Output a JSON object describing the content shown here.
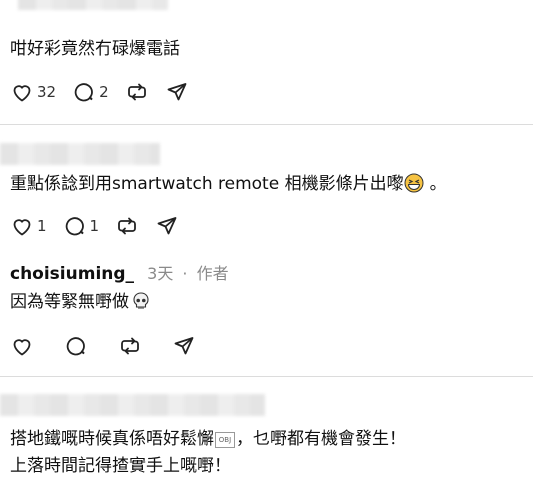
{
  "post1": {
    "text": "咁好彩竟然冇碌爆電話",
    "likes": "32",
    "replies": "2"
  },
  "post2": {
    "text": "重點係諗到用smartwatch remote 相機影條片出嚟",
    "emoji": "grinning-squinting-face",
    "suffix": "。",
    "likes": "1",
    "replies": "1"
  },
  "post3": {
    "author": "choisiuming_",
    "time": "3天",
    "separator": "·",
    "role": "作者",
    "text": "因為等緊無嘢做",
    "emoji": "skull"
  },
  "post4": {
    "line1_a": "搭地鐵嘅時候真係唔好鬆懈",
    "glyph": "OBJ",
    "line1_b": "，乜嘢都有機會發生！",
    "line2": "上落時間記得揸實手上嘅嘢！"
  },
  "icons": [
    "heart-icon",
    "comment-icon",
    "repost-icon",
    "share-icon"
  ]
}
